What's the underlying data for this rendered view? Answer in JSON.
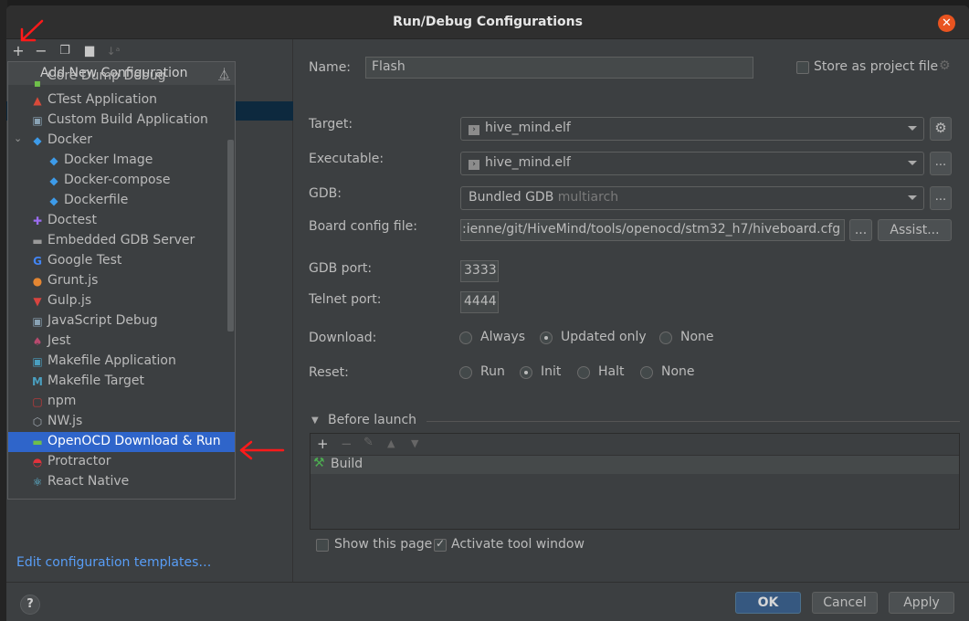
{
  "dialog": {
    "title": "Run/Debug Configurations"
  },
  "left_toolbar": {
    "icons": [
      "add-icon",
      "remove-icon",
      "copy-icon",
      "new-folder-icon",
      "sort-icon"
    ]
  },
  "add_popup": {
    "title": "Add New Configuration",
    "items": [
      {
        "label": "Core Dump Debug",
        "icon": "core-dump-icon"
      },
      {
        "label": "CTest Application",
        "icon": "ctest-icon"
      },
      {
        "label": "Custom Build Application",
        "icon": "custom-build-icon"
      },
      {
        "label": "Docker",
        "icon": "docker-icon",
        "expanded": true
      },
      {
        "label": "Docker Image",
        "icon": "docker-icon",
        "child": true
      },
      {
        "label": "Docker-compose",
        "icon": "docker-icon",
        "child": true
      },
      {
        "label": "Dockerfile",
        "icon": "docker-icon",
        "child": true
      },
      {
        "label": "Doctest",
        "icon": "doctest-icon"
      },
      {
        "label": "Embedded GDB Server",
        "icon": "embedded-gdb-icon"
      },
      {
        "label": "Google Test",
        "icon": "google-test-icon"
      },
      {
        "label": "Grunt.js",
        "icon": "grunt-icon"
      },
      {
        "label": "Gulp.js",
        "icon": "gulp-icon"
      },
      {
        "label": "JavaScript Debug",
        "icon": "javascript-debug-icon"
      },
      {
        "label": "Jest",
        "icon": "jest-icon"
      },
      {
        "label": "Makefile Application",
        "icon": "makefile-app-icon"
      },
      {
        "label": "Makefile Target",
        "icon": "makefile-target-icon"
      },
      {
        "label": "npm",
        "icon": "npm-icon"
      },
      {
        "label": "NW.js",
        "icon": "nwjs-icon"
      },
      {
        "label": "OpenOCD Download & Run",
        "icon": "openocd-icon",
        "selected": true
      },
      {
        "label": "Protractor",
        "icon": "protractor-icon"
      },
      {
        "label": "React Native",
        "icon": "react-native-icon"
      }
    ]
  },
  "edit_templates_link": "Edit configuration templates…",
  "form": {
    "name_label": "Name:",
    "name_value": "Flash",
    "store_as_project_file": "Store as project file",
    "store_checked": false,
    "target_label": "Target:",
    "target_value": "hive_mind.elf",
    "executable_label": "Executable:",
    "executable_value": "hive_mind.elf",
    "gdb_label": "GDB:",
    "gdb_value": "Bundled GDB",
    "gdb_hint": "multiarch",
    "board_config_label": "Board config file:",
    "board_config_value": ":ienne/git/HiveMind/tools/openocd/stm32_h7/hiveboard.cfg",
    "browse_label": "...",
    "assist_label": "Assist...",
    "gdb_port_label": "GDB port:",
    "gdb_port_value": "3333",
    "telnet_port_label": "Telnet port:",
    "telnet_port_value": "4444",
    "download_label": "Download:",
    "download_options": [
      "Always",
      "Updated only",
      "None"
    ],
    "download_selected": "Updated only",
    "reset_label": "Reset:",
    "reset_options": [
      "Run",
      "Init",
      "Halt",
      "None"
    ],
    "reset_selected": "Init"
  },
  "before_launch": {
    "title": "Before launch",
    "tasks": [
      "Build"
    ],
    "show_this_page": "Show this page",
    "show_this_page_checked": false,
    "activate_tool_window": "Activate tool window",
    "activate_tool_window_checked": true
  },
  "buttons": {
    "help": "?",
    "ok": "OK",
    "cancel": "Cancel",
    "apply": "Apply"
  },
  "colors": {
    "accent_selected": "#2f65ca",
    "primary_button": "#365880",
    "link": "#589df6",
    "close_button": "#e95420",
    "annotation": "#ff0000"
  }
}
